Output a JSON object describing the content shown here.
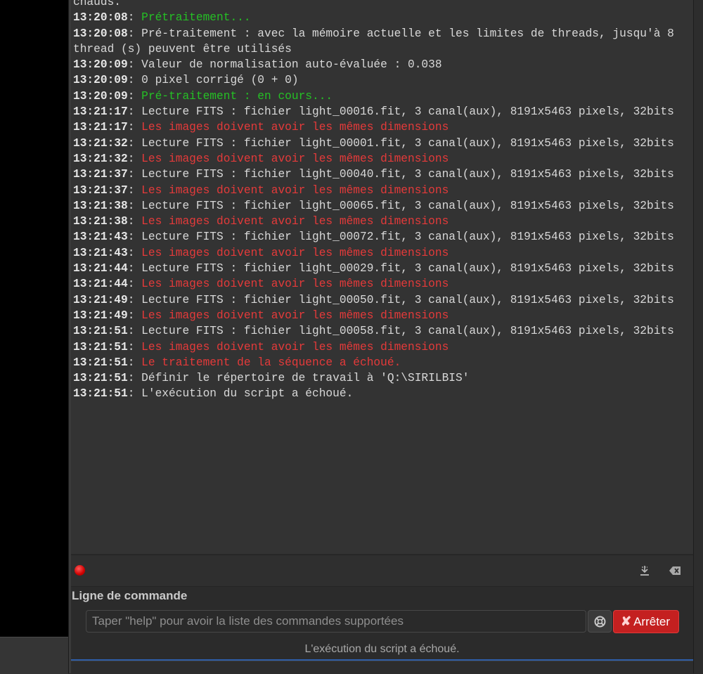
{
  "log": [
    {
      "ts": "",
      "text": "chauds.",
      "color": "default"
    },
    {
      "ts": "13:20:08",
      "text": "Prétraitement...",
      "color": "green"
    },
    {
      "ts": "13:20:08",
      "text": "Pré-traitement : avec la mémoire actuelle et les limites de threads, jusqu'à 8 thread (s) peuvent être utilisés",
      "color": "default"
    },
    {
      "ts": "13:20:09",
      "text": "Valeur de normalisation auto-évaluée : 0.038",
      "color": "default"
    },
    {
      "ts": "13:20:09",
      "text": "0 pixel corrigé (0 + 0)",
      "color": "default"
    },
    {
      "ts": "13:20:09",
      "text": "Pré-traitement : en cours...",
      "color": "green"
    },
    {
      "ts": "13:21:17",
      "text": "Lecture FITS : fichier light_00016.fit, 3 canal(aux), 8191x5463 pixels, 32bits",
      "color": "default"
    },
    {
      "ts": "13:21:17",
      "text": "Les images doivent avoir les mêmes dimensions",
      "color": "red"
    },
    {
      "ts": "13:21:32",
      "text": "Lecture FITS : fichier light_00001.fit, 3 canal(aux), 8191x5463 pixels, 32bits",
      "color": "default"
    },
    {
      "ts": "13:21:32",
      "text": "Les images doivent avoir les mêmes dimensions",
      "color": "red"
    },
    {
      "ts": "13:21:37",
      "text": "Lecture FITS : fichier light_00040.fit, 3 canal(aux), 8191x5463 pixels, 32bits",
      "color": "default"
    },
    {
      "ts": "13:21:37",
      "text": "Les images doivent avoir les mêmes dimensions",
      "color": "red"
    },
    {
      "ts": "13:21:38",
      "text": "Lecture FITS : fichier light_00065.fit, 3 canal(aux), 8191x5463 pixels, 32bits",
      "color": "default"
    },
    {
      "ts": "13:21:38",
      "text": "Les images doivent avoir les mêmes dimensions",
      "color": "red"
    },
    {
      "ts": "13:21:43",
      "text": "Lecture FITS : fichier light_00072.fit, 3 canal(aux), 8191x5463 pixels, 32bits",
      "color": "default"
    },
    {
      "ts": "13:21:43",
      "text": "Les images doivent avoir les mêmes dimensions",
      "color": "red"
    },
    {
      "ts": "13:21:44",
      "text": "Lecture FITS : fichier light_00029.fit, 3 canal(aux), 8191x5463 pixels, 32bits",
      "color": "default"
    },
    {
      "ts": "13:21:44",
      "text": "Les images doivent avoir les mêmes dimensions",
      "color": "red"
    },
    {
      "ts": "13:21:49",
      "text": "Lecture FITS : fichier light_00050.fit, 3 canal(aux), 8191x5463 pixels, 32bits",
      "color": "default"
    },
    {
      "ts": "13:21:49",
      "text": "Les images doivent avoir les mêmes dimensions",
      "color": "red"
    },
    {
      "ts": "13:21:51",
      "text": "Lecture FITS : fichier light_00058.fit, 3 canal(aux), 8191x5463 pixels, 32bits",
      "color": "default"
    },
    {
      "ts": "13:21:51",
      "text": "Les images doivent avoir les mêmes dimensions",
      "color": "red"
    },
    {
      "ts": "13:21:51",
      "text": "Le traitement de la séquence a échoué.",
      "color": "red"
    },
    {
      "ts": "13:21:51",
      "text": "Définir le répertoire de travail à 'Q:\\SIRILBIS'",
      "color": "default"
    },
    {
      "ts": "13:21:51",
      "text": "L'exécution du script a échoué.",
      "color": "default"
    }
  ],
  "toolbar": {
    "record_icon": "record-icon",
    "download_icon": "download-icon",
    "clear_icon": "clear-log-icon"
  },
  "command": {
    "label": "Ligne de commande",
    "placeholder": "Taper \"help\" pour avoir la liste des commandes supportées",
    "value": "",
    "help_icon": "lifebuoy-icon",
    "stop_label": "Arrêter",
    "stop_icon": "✘"
  },
  "status": {
    "text": "L'exécution du script a échoué."
  },
  "colors": {
    "green": "#25c025",
    "red": "#e43a3a",
    "stop_button": "#c42020",
    "record": "#d00000"
  }
}
